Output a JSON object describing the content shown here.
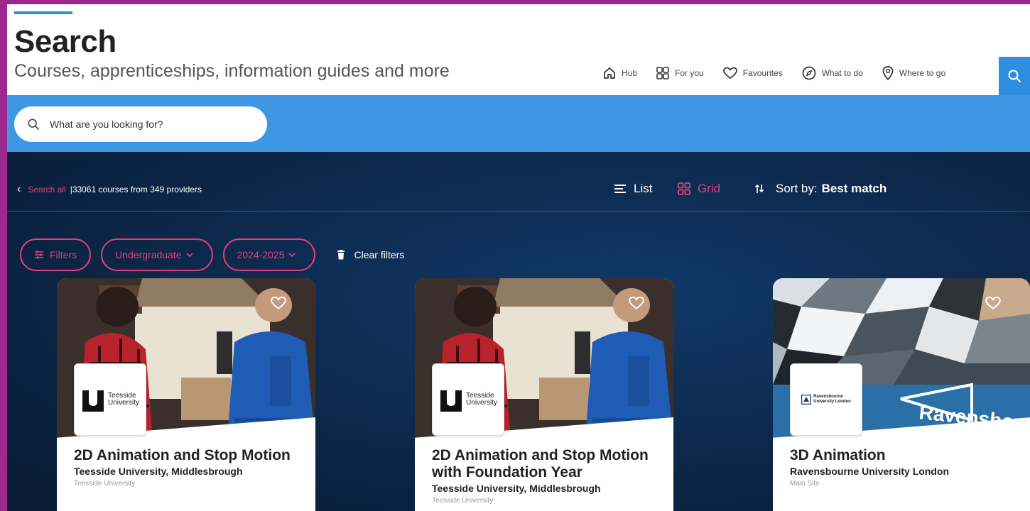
{
  "header": {
    "title": "Search",
    "subtitle": "Courses, apprenticeships, information guides and more"
  },
  "nav": {
    "items": [
      {
        "label": "Hub",
        "icon": "home-icon"
      },
      {
        "label": "For you",
        "icon": "grid-icon"
      },
      {
        "label": "Favourites",
        "icon": "heart-icon"
      },
      {
        "label": "What to do",
        "icon": "compass-icon"
      },
      {
        "label": "Where to go",
        "icon": "location-pin-icon"
      }
    ]
  },
  "search": {
    "placeholder": "What are you looking for?"
  },
  "results": {
    "back_label": "Search all",
    "count_text": "|33061 courses from 349 providers",
    "view_list": "List",
    "view_grid": "Grid",
    "sort_label": "Sort by:",
    "sort_value": "Best match"
  },
  "filters": {
    "filters_label": "Filters",
    "level": "Undergraduate",
    "year": "2024-2025",
    "clear_label": "Clear filters"
  },
  "cards": [
    {
      "title": "2D Animation and Stop Motion",
      "provider": "Teesside University, Middlesbrough",
      "site": "Teesside University",
      "logo_line1": "Teesside",
      "logo_line2": "University"
    },
    {
      "title": "2D Animation and Stop Motion with Foundation Year",
      "provider": "Teesside University, Middlesbrough",
      "site": "Teesside University",
      "logo_line1": "Teesside",
      "logo_line2": "University"
    },
    {
      "title": "3D Animation",
      "provider": "Ravensbourne University London",
      "site": "Main Site",
      "logo_line1": "Ravensbourne",
      "logo_line2": "University London",
      "image_text": "Ravensbou"
    }
  ],
  "colors": {
    "brand_blue": "#3f97e4",
    "accent_pink": "#e23d7e",
    "dark_navy": "#0e2a4e",
    "outer_frame": "#9b2a8c"
  }
}
